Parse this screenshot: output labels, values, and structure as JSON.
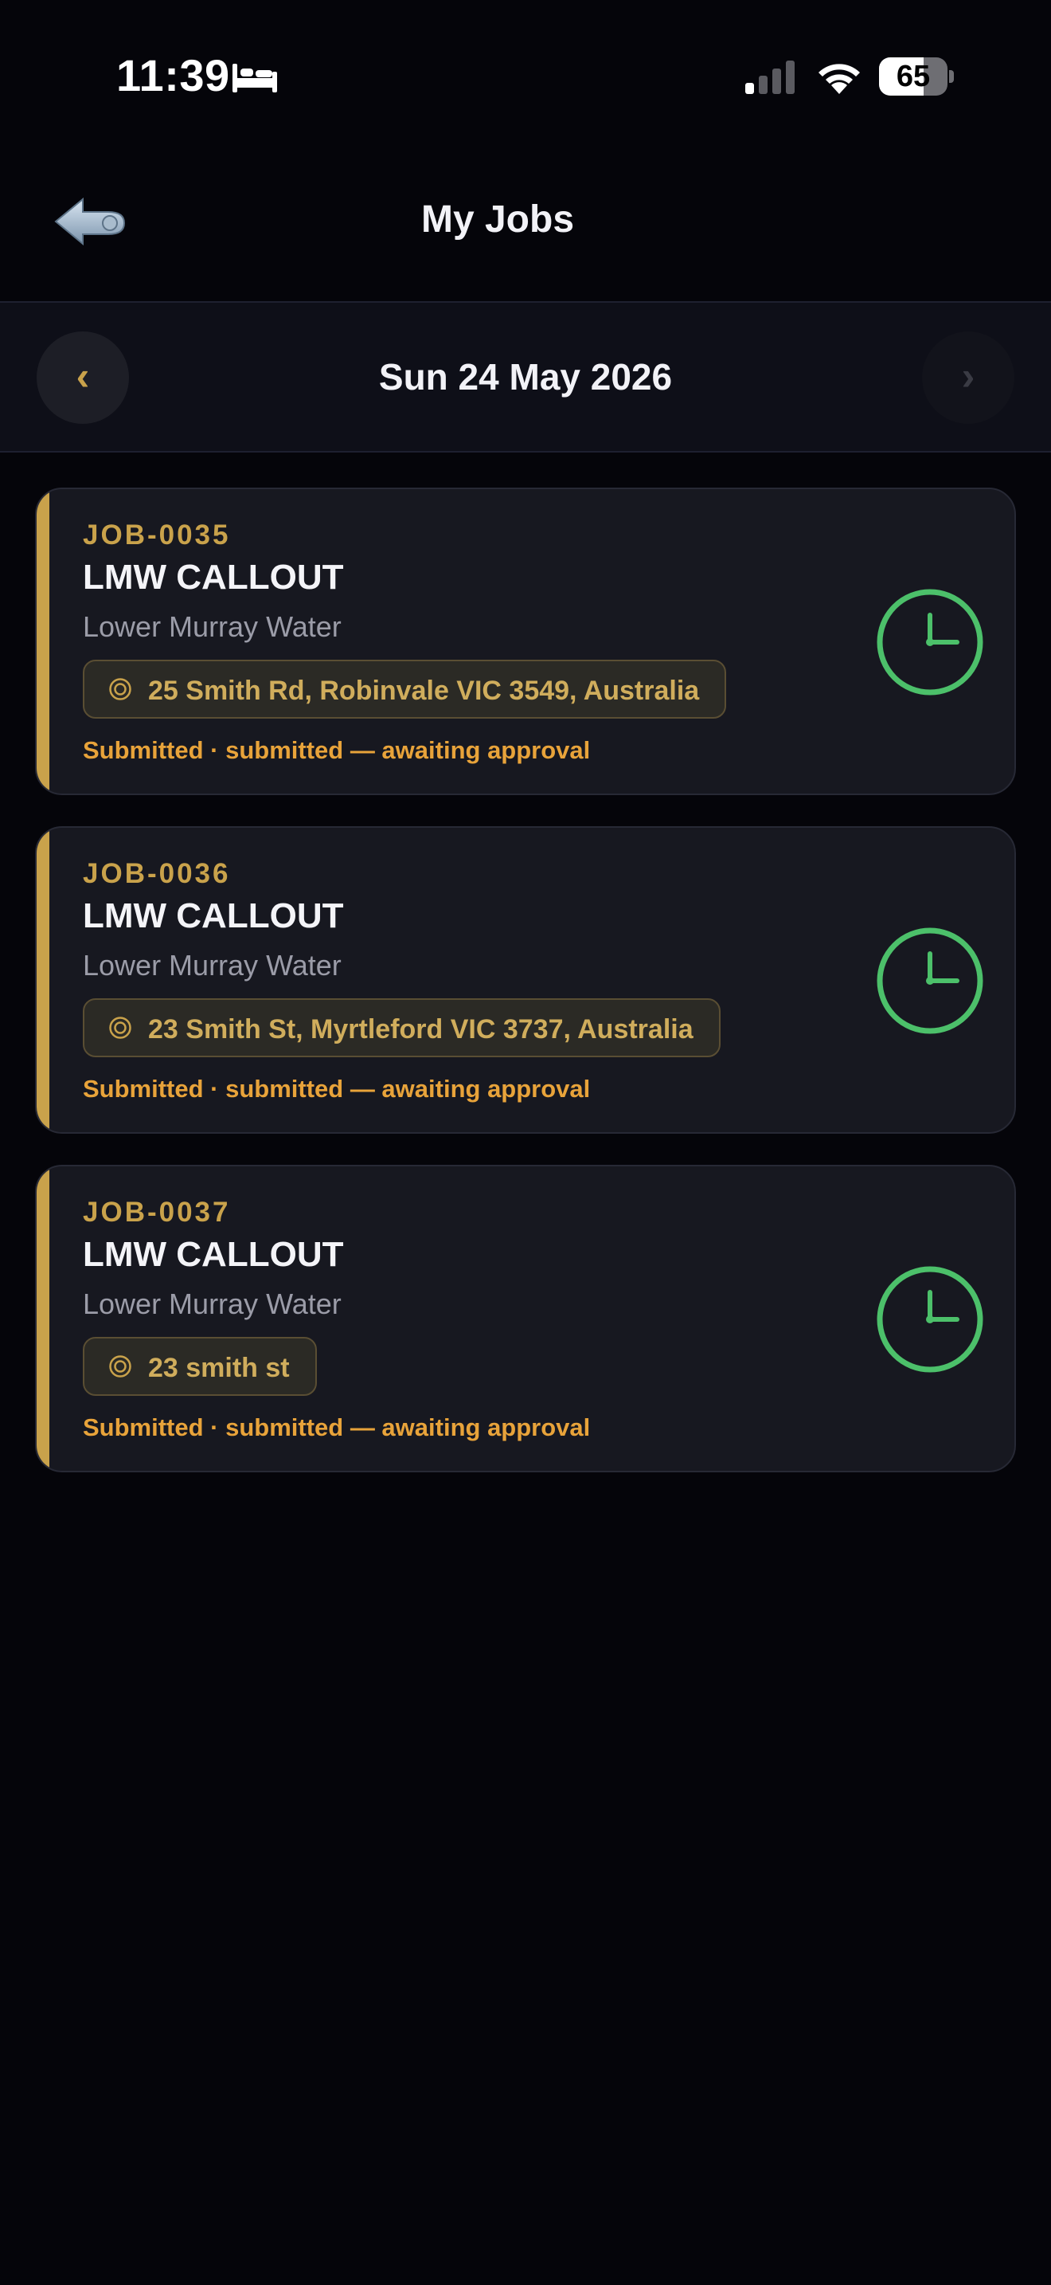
{
  "status_bar": {
    "time": "11:39",
    "battery_level": "65",
    "battery_fraction": 0.65,
    "icons": [
      "bed-icon",
      "signal-icon",
      "wifi-icon",
      "battery-icon"
    ]
  },
  "header": {
    "title": "My Jobs",
    "back_icon": "back-arrow-icon"
  },
  "date_bar": {
    "date": "Sun 24 May 2026",
    "prev_label": "‹",
    "next_label": "›"
  },
  "colors": {
    "accent_gold": "#c9a24b",
    "status_orange": "#e8a33a",
    "clock_green": "#4cc06a",
    "card_bg": "#171820",
    "page_bg": "#05050a"
  },
  "jobs": [
    {
      "id": "JOB-0035",
      "type": "LMW CALLOUT",
      "client": "Lower Murray Water",
      "address": "25 Smith Rd, Robinvale VIC 3549, Australia",
      "status": "Submitted · submitted — awaiting approval",
      "status_icon": "clock-icon"
    },
    {
      "id": "JOB-0036",
      "type": "LMW CALLOUT",
      "client": "Lower Murray Water",
      "address": "23 Smith St, Myrtleford VIC 3737, Australia",
      "status": "Submitted · submitted — awaiting approval",
      "status_icon": "clock-icon"
    },
    {
      "id": "JOB-0037",
      "type": "LMW CALLOUT",
      "client": "Lower Murray Water",
      "address": "23 smith st",
      "status": "Submitted · submitted — awaiting approval",
      "status_icon": "clock-icon"
    }
  ]
}
